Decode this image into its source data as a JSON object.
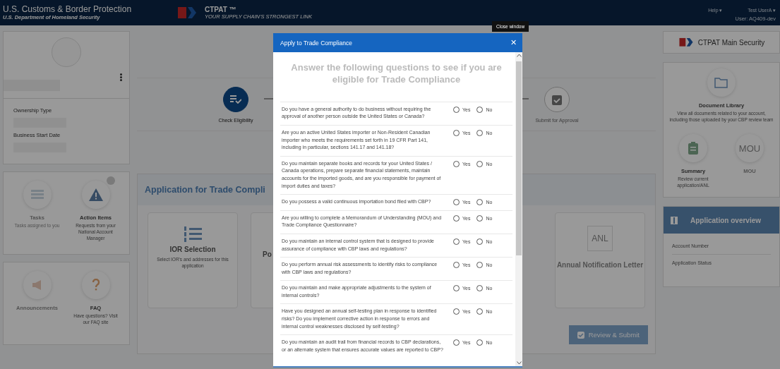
{
  "header": {
    "agency": "U.S. Customs & Border Protection",
    "department": "U.S. Department of Homeland Security",
    "brand": "CTPAT ™",
    "tagline": "YOUR SUPPLY CHAIN'S STRONGEST LINK",
    "help": "Help ▾",
    "user": "Test UserA ▾",
    "user_id": "User: AQ409-dev"
  },
  "profile": {
    "fields": [
      "Ownership Type",
      "Business Start Date"
    ]
  },
  "quick_tiles": [
    {
      "kind": "tasks",
      "title": "Tasks",
      "subtitle": "Tasks assigned to you",
      "dimmed": true
    },
    {
      "kind": "alert",
      "title": "Action Items",
      "subtitle": "Requests from your National Account Manager",
      "dimmed": false
    },
    {
      "kind": "megaphone",
      "title": "Announcements",
      "dimmed": true
    },
    {
      "kind": "question",
      "title": "FAQ",
      "subtitle": "Have questions? Visit our FAQ site",
      "dimmed": false
    }
  ],
  "steps": [
    {
      "label": "Check Eligibility",
      "selected": true
    },
    {
      "label": "Submit for Approval",
      "selected": false
    }
  ],
  "application": {
    "title": "Application for Trade Compli",
    "tiles": [
      {
        "kind": "list",
        "title": "IOR Selection",
        "subtitle": "Select IOR's and addresses for this application"
      },
      {
        "kind": "blank",
        "title": "Po"
      },
      {
        "kind": "anl",
        "title": "Annual Notification Letter",
        "badge": "ANL"
      }
    ],
    "submit": "Review & Submit"
  },
  "program": {
    "name": "CTPAT Main Security"
  },
  "library": {
    "title": "Document Library",
    "subtitle": "View all documents related to your account, including those uploaded by your CBP review team",
    "tiles": [
      {
        "kind": "clipboard",
        "title": "Summary",
        "subtitle": "Review current application/ANL"
      },
      {
        "kind": "text",
        "badge": "MOU",
        "title": "MOU"
      }
    ]
  },
  "overview": {
    "title": "Application overview",
    "rows": [
      "Account Number",
      "Application Status"
    ]
  },
  "tooltip": "Close window",
  "modal": {
    "title": "Apply to Trade Compliance",
    "close": "✕",
    "heading": "Answer the following questions to see if you are eligible for Trade Compliance",
    "questions": [
      {
        "text": "Do you have a general authority to do business without requiring the approval of another person outside the United States or Canada?",
        "options": [
          {
            "label": "Yes",
            "selected": false
          },
          {
            "label": "No",
            "selected": false
          }
        ]
      },
      {
        "text": "Are you an active United States importer or Non-Resident Canadian importer who meets the requirements set forth in 19 CFR Part 141, including in particular, sections 141.17 and 141.18?",
        "options": [
          {
            "label": "Yes",
            "selected": false
          },
          {
            "label": "No",
            "selected": false
          }
        ]
      },
      {
        "text": "Do you maintain separate books and records for your United States / Canada operations, prepare separate financial statements, maintain accounts for the imported goods, and are you responsible for payment of import duties and taxes?",
        "options": [
          {
            "label": "Yes",
            "selected": false
          },
          {
            "label": "No",
            "selected": false
          }
        ]
      },
      {
        "text": "Do you possess a valid continuous importation bond filed with CBP?",
        "options": [
          {
            "label": "Yes",
            "selected": false
          },
          {
            "label": "No",
            "selected": false
          }
        ]
      },
      {
        "text": "Are you willing to complete a Memorandum of Understanding (MOU) and Trade Compliance Questionnaire?",
        "options": [
          {
            "label": "Yes",
            "selected": false
          },
          {
            "label": "No",
            "selected": false
          }
        ]
      },
      {
        "text": "Do you maintain an internal control system that is designed to provide assurance of compliance with CBP laws and regulations?",
        "options": [
          {
            "label": "Yes",
            "selected": false
          },
          {
            "label": "No",
            "selected": false
          }
        ]
      },
      {
        "text": "Do you perform annual risk assessments to identify risks to compliance with CBP laws and regulations?",
        "options": [
          {
            "label": "Yes",
            "selected": false
          },
          {
            "label": "No",
            "selected": false
          }
        ]
      },
      {
        "text": "Do you maintain and make appropriate adjustments to the system of internal controls?",
        "options": [
          {
            "label": "Yes",
            "selected": false
          },
          {
            "label": "No",
            "selected": false
          }
        ]
      },
      {
        "text": "Have you designed an annual self-testing plan in response to identified risks? Do you implement corrective action in response to errors and internal control weaknesses disclosed by self-testing?",
        "options": [
          {
            "label": "Yes",
            "selected": false
          },
          {
            "label": "No",
            "selected": false
          }
        ]
      },
      {
        "text": "Do you maintain an audit trail from financial records to CBP declarations, or an alternate system that ensures accurate values are reported to CBP?",
        "options": [
          {
            "label": "Yes",
            "selected": false
          },
          {
            "label": "No",
            "selected": false
          }
        ]
      }
    ]
  }
}
